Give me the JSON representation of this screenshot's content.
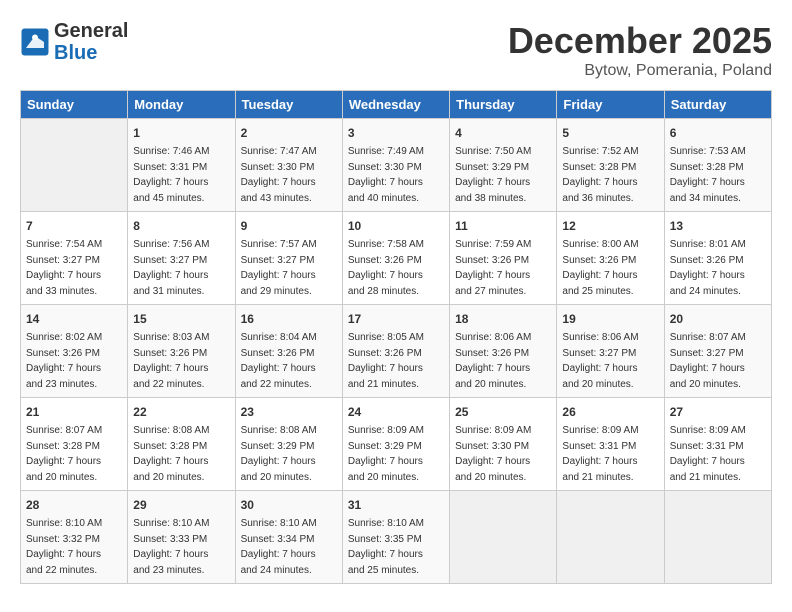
{
  "header": {
    "logo_line1": "General",
    "logo_line2": "Blue",
    "month": "December 2025",
    "location": "Bytow, Pomerania, Poland"
  },
  "days_of_week": [
    "Sunday",
    "Monday",
    "Tuesday",
    "Wednesday",
    "Thursday",
    "Friday",
    "Saturday"
  ],
  "weeks": [
    [
      {
        "num": "",
        "data": ""
      },
      {
        "num": "1",
        "data": "Sunrise: 7:46 AM\nSunset: 3:31 PM\nDaylight: 7 hours\nand 45 minutes."
      },
      {
        "num": "2",
        "data": "Sunrise: 7:47 AM\nSunset: 3:30 PM\nDaylight: 7 hours\nand 43 minutes."
      },
      {
        "num": "3",
        "data": "Sunrise: 7:49 AM\nSunset: 3:30 PM\nDaylight: 7 hours\nand 40 minutes."
      },
      {
        "num": "4",
        "data": "Sunrise: 7:50 AM\nSunset: 3:29 PM\nDaylight: 7 hours\nand 38 minutes."
      },
      {
        "num": "5",
        "data": "Sunrise: 7:52 AM\nSunset: 3:28 PM\nDaylight: 7 hours\nand 36 minutes."
      },
      {
        "num": "6",
        "data": "Sunrise: 7:53 AM\nSunset: 3:28 PM\nDaylight: 7 hours\nand 34 minutes."
      }
    ],
    [
      {
        "num": "7",
        "data": "Sunrise: 7:54 AM\nSunset: 3:27 PM\nDaylight: 7 hours\nand 33 minutes."
      },
      {
        "num": "8",
        "data": "Sunrise: 7:56 AM\nSunset: 3:27 PM\nDaylight: 7 hours\nand 31 minutes."
      },
      {
        "num": "9",
        "data": "Sunrise: 7:57 AM\nSunset: 3:27 PM\nDaylight: 7 hours\nand 29 minutes."
      },
      {
        "num": "10",
        "data": "Sunrise: 7:58 AM\nSunset: 3:26 PM\nDaylight: 7 hours\nand 28 minutes."
      },
      {
        "num": "11",
        "data": "Sunrise: 7:59 AM\nSunset: 3:26 PM\nDaylight: 7 hours\nand 27 minutes."
      },
      {
        "num": "12",
        "data": "Sunrise: 8:00 AM\nSunset: 3:26 PM\nDaylight: 7 hours\nand 25 minutes."
      },
      {
        "num": "13",
        "data": "Sunrise: 8:01 AM\nSunset: 3:26 PM\nDaylight: 7 hours\nand 24 minutes."
      }
    ],
    [
      {
        "num": "14",
        "data": "Sunrise: 8:02 AM\nSunset: 3:26 PM\nDaylight: 7 hours\nand 23 minutes."
      },
      {
        "num": "15",
        "data": "Sunrise: 8:03 AM\nSunset: 3:26 PM\nDaylight: 7 hours\nand 22 minutes."
      },
      {
        "num": "16",
        "data": "Sunrise: 8:04 AM\nSunset: 3:26 PM\nDaylight: 7 hours\nand 22 minutes."
      },
      {
        "num": "17",
        "data": "Sunrise: 8:05 AM\nSunset: 3:26 PM\nDaylight: 7 hours\nand 21 minutes."
      },
      {
        "num": "18",
        "data": "Sunrise: 8:06 AM\nSunset: 3:26 PM\nDaylight: 7 hours\nand 20 minutes."
      },
      {
        "num": "19",
        "data": "Sunrise: 8:06 AM\nSunset: 3:27 PM\nDaylight: 7 hours\nand 20 minutes."
      },
      {
        "num": "20",
        "data": "Sunrise: 8:07 AM\nSunset: 3:27 PM\nDaylight: 7 hours\nand 20 minutes."
      }
    ],
    [
      {
        "num": "21",
        "data": "Sunrise: 8:07 AM\nSunset: 3:28 PM\nDaylight: 7 hours\nand 20 minutes."
      },
      {
        "num": "22",
        "data": "Sunrise: 8:08 AM\nSunset: 3:28 PM\nDaylight: 7 hours\nand 20 minutes."
      },
      {
        "num": "23",
        "data": "Sunrise: 8:08 AM\nSunset: 3:29 PM\nDaylight: 7 hours\nand 20 minutes."
      },
      {
        "num": "24",
        "data": "Sunrise: 8:09 AM\nSunset: 3:29 PM\nDaylight: 7 hours\nand 20 minutes."
      },
      {
        "num": "25",
        "data": "Sunrise: 8:09 AM\nSunset: 3:30 PM\nDaylight: 7 hours\nand 20 minutes."
      },
      {
        "num": "26",
        "data": "Sunrise: 8:09 AM\nSunset: 3:31 PM\nDaylight: 7 hours\nand 21 minutes."
      },
      {
        "num": "27",
        "data": "Sunrise: 8:09 AM\nSunset: 3:31 PM\nDaylight: 7 hours\nand 21 minutes."
      }
    ],
    [
      {
        "num": "28",
        "data": "Sunrise: 8:10 AM\nSunset: 3:32 PM\nDaylight: 7 hours\nand 22 minutes."
      },
      {
        "num": "29",
        "data": "Sunrise: 8:10 AM\nSunset: 3:33 PM\nDaylight: 7 hours\nand 23 minutes."
      },
      {
        "num": "30",
        "data": "Sunrise: 8:10 AM\nSunset: 3:34 PM\nDaylight: 7 hours\nand 24 minutes."
      },
      {
        "num": "31",
        "data": "Sunrise: 8:10 AM\nSunset: 3:35 PM\nDaylight: 7 hours\nand 25 minutes."
      },
      {
        "num": "",
        "data": ""
      },
      {
        "num": "",
        "data": ""
      },
      {
        "num": "",
        "data": ""
      }
    ]
  ]
}
